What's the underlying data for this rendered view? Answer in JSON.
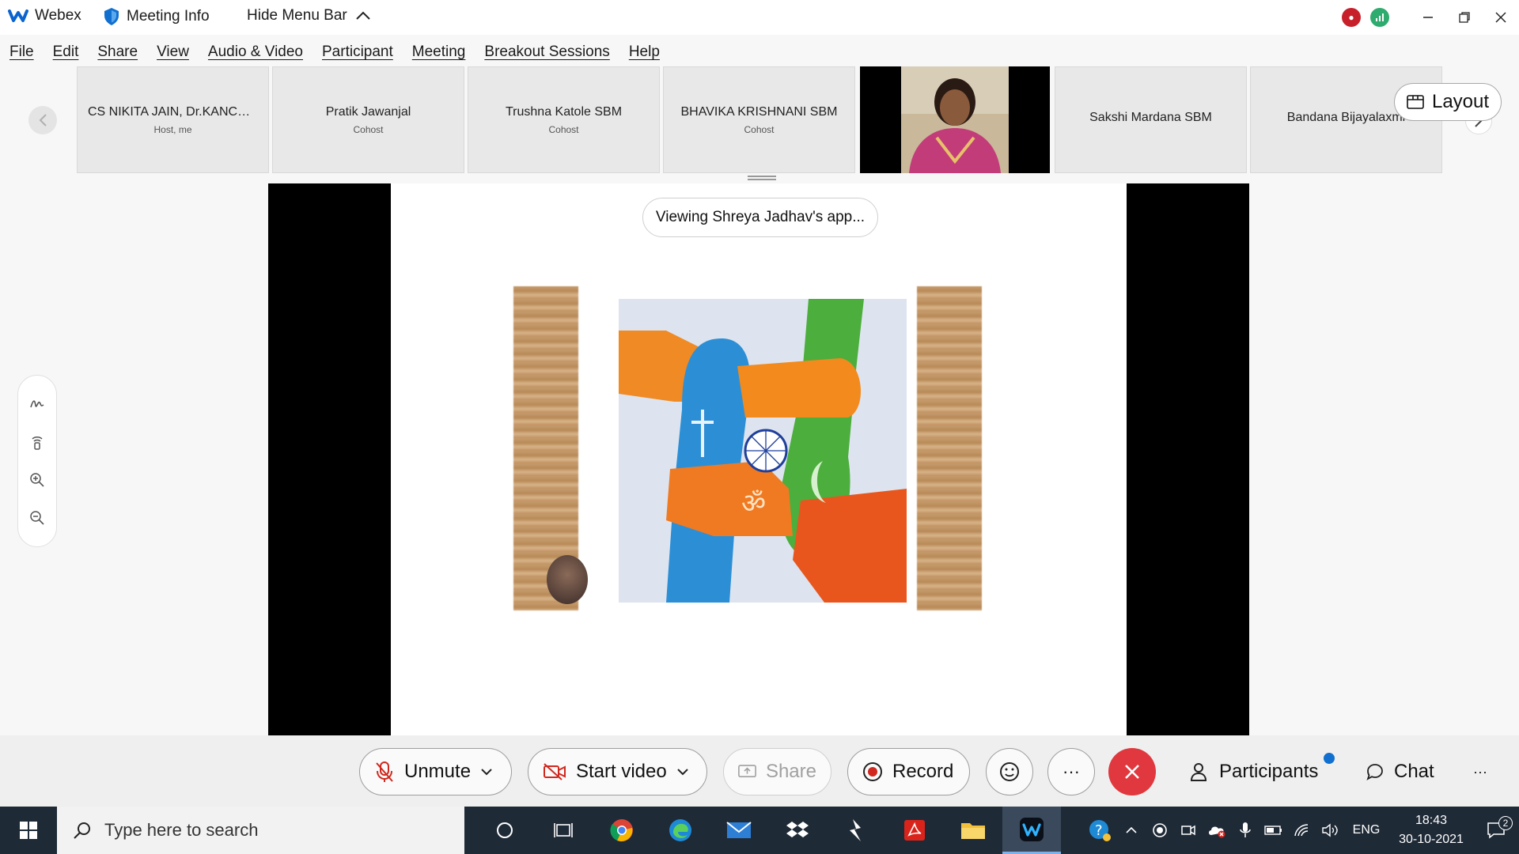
{
  "titlebar": {
    "app_name": "Webex",
    "meeting_info": "Meeting Info",
    "hide_menu": "Hide Menu Bar"
  },
  "menu": [
    "File",
    "Edit",
    "Share",
    "View",
    "Audio & Video",
    "Participant",
    "Meeting",
    "Breakout Sessions",
    "Help"
  ],
  "participants": [
    {
      "name": "CS NIKITA JAIN, Dr.KANCHA...",
      "role": "Host, me"
    },
    {
      "name": "Pratik Jawanjal",
      "role": "Cohost"
    },
    {
      "name": "Trushna Katole SBM",
      "role": "Cohost"
    },
    {
      "name": "BHAVIKA KRISHNANI SBM",
      "role": "Cohost"
    },
    {
      "name": "Sakshi Mardana SBM",
      "role": ""
    },
    {
      "name": "Bandana Bijayalaxmi",
      "role": ""
    }
  ],
  "layout_label": "Layout",
  "share": {
    "viewing_label": "Viewing Shreya Jadhav's app..."
  },
  "controls": {
    "unmute": "Unmute",
    "start_video": "Start video",
    "share": "Share",
    "record": "Record",
    "participants": "Participants",
    "chat": "Chat"
  },
  "taskbar": {
    "search_placeholder": "Type here to search",
    "lang": "ENG",
    "time": "18:43",
    "date": "30-10-2021",
    "notifications": "2"
  },
  "colors": {
    "end_call": "#e0383e",
    "accent_blue": "#1170cf",
    "taskbar_bg": "#1f2a37"
  }
}
